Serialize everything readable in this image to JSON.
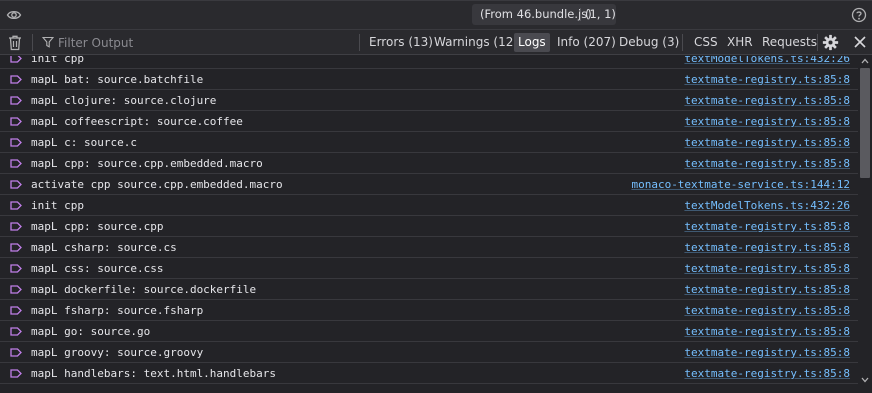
{
  "topbar": {
    "source_file": "(From 46.bundle.js)",
    "source_position": "(1, 1)"
  },
  "toolbar": {
    "filter_placeholder": "Filter Output",
    "levels": {
      "errors": "Errors (13)",
      "warnings": "Warnings (12)",
      "logs": "Logs",
      "info": "Info (207)",
      "debug": "Debug (3)"
    },
    "types": {
      "css": "CSS",
      "xhr": "XHR",
      "requests": "Requests"
    },
    "active_level": "Logs"
  },
  "log_entries": [
    {
      "message": "init cpp",
      "source": "textModelTokens.ts:432:26"
    },
    {
      "message": "mapL bat: source.batchfile",
      "source": "textmate-registry.ts:85:8"
    },
    {
      "message": "mapL clojure: source.clojure",
      "source": "textmate-registry.ts:85:8"
    },
    {
      "message": "mapL coffeescript: source.coffee",
      "source": "textmate-registry.ts:85:8"
    },
    {
      "message": "mapL c: source.c",
      "source": "textmate-registry.ts:85:8"
    },
    {
      "message": "mapL cpp: source.cpp.embedded.macro",
      "source": "textmate-registry.ts:85:8"
    },
    {
      "message": "activate cpp source.cpp.embedded.macro",
      "source": "monaco-textmate-service.ts:144:12"
    },
    {
      "message": "init cpp",
      "source": "textModelTokens.ts:432:26"
    },
    {
      "message": "mapL cpp: source.cpp",
      "source": "textmate-registry.ts:85:8"
    },
    {
      "message": "mapL csharp: source.cs",
      "source": "textmate-registry.ts:85:8"
    },
    {
      "message": "mapL css: source.css",
      "source": "textmate-registry.ts:85:8"
    },
    {
      "message": "mapL dockerfile: source.dockerfile",
      "source": "textmate-registry.ts:85:8"
    },
    {
      "message": "mapL fsharp: source.fsharp",
      "source": "textmate-registry.ts:85:8"
    },
    {
      "message": "mapL go: source.go",
      "source": "textmate-registry.ts:85:8"
    },
    {
      "message": "mapL groovy: source.groovy",
      "source": "textmate-registry.ts:85:8"
    },
    {
      "message": "mapL handlebars: text.html.handlebars",
      "source": "textmate-registry.ts:85:8"
    }
  ],
  "colors": {
    "background": "#232327",
    "toolbar": "#2a2a2e",
    "link": "#75bfff",
    "log_icon": "#c07fe8"
  },
  "icons": {
    "eye": "eye-icon",
    "help": "help-icon",
    "trash": "trash-icon",
    "filter": "filter-icon",
    "gear": "gear-icon",
    "close": "close-icon",
    "log": "log-tag-icon"
  }
}
